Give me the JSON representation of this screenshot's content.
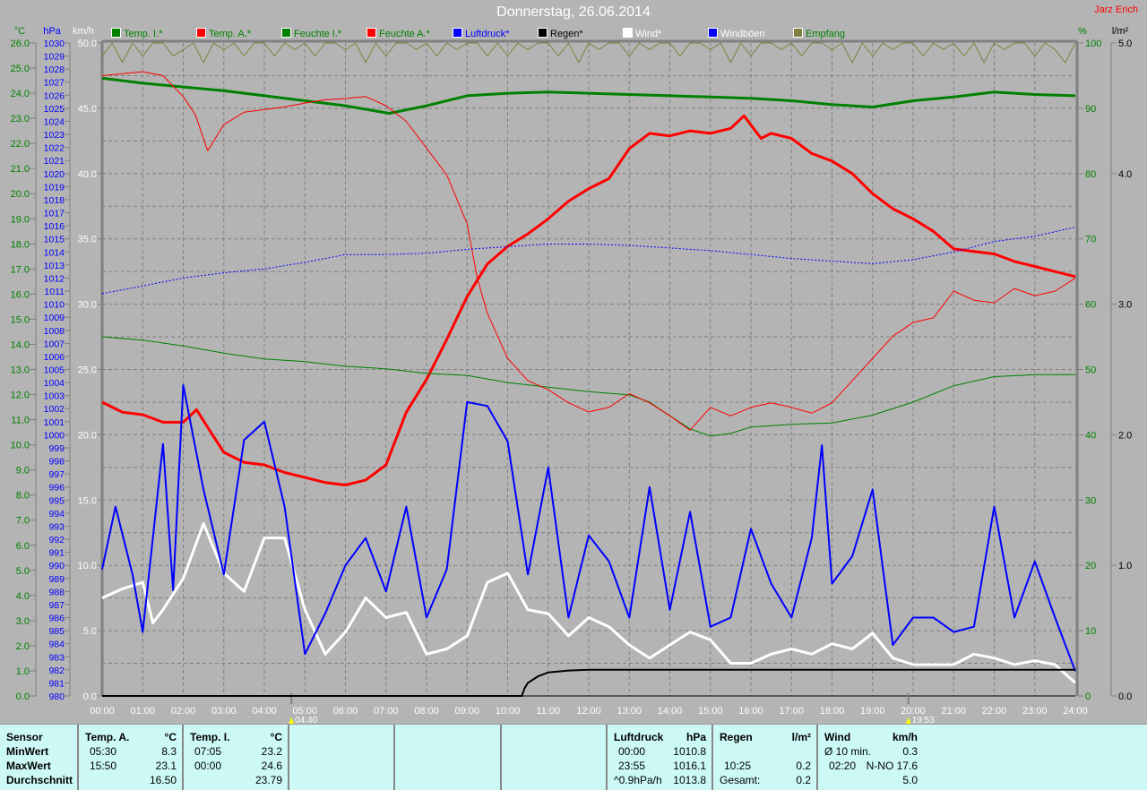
{
  "header": {
    "title": "Donnerstag, 26.06.2014",
    "author": "Jarz Erich"
  },
  "legend": [
    {
      "label": "Temp. I.*",
      "swatch": "#008000",
      "text_color": "#008000"
    },
    {
      "label": "Temp. A.*",
      "swatch": "#ff0000",
      "text_color": "#008000"
    },
    {
      "label": "Feuchte I.*",
      "swatch": "#008000",
      "text_color": "#008000"
    },
    {
      "label": "Feuchte A.*",
      "swatch": "#ff0000",
      "text_color": "#008000"
    },
    {
      "label": "Luftdruck*",
      "swatch": "#0000ff",
      "text_color": "#0000ff"
    },
    {
      "label": "Regen*",
      "swatch": "#000000",
      "text_color": "#000000"
    },
    {
      "label": "Wind*",
      "swatch": "#ffffff",
      "text_color": "#ffffff"
    },
    {
      "label": "Windböen",
      "swatch": "#0000ff",
      "text_color": "#ffffff"
    },
    {
      "label": "Empfang",
      "swatch": "#808040",
      "text_color": "#008000"
    }
  ],
  "chart_data": {
    "type": "line",
    "title": "Donnerstag, 26.06.2014",
    "x_unit": "hours",
    "xlim": [
      0,
      24
    ],
    "x_tick_labels": [
      "00:00",
      "01:00",
      "02:00",
      "03:00",
      "04:00",
      "05:00",
      "06:00",
      "07:00",
      "08:00",
      "09:00",
      "10:00",
      "11:00",
      "12:00",
      "13:00",
      "14:00",
      "15:00",
      "16:00",
      "17:00",
      "18:00",
      "19:00",
      "20:00",
      "21:00",
      "22:00",
      "23:00",
      "24:00"
    ],
    "axes": {
      "temp": {
        "unit": "°C",
        "range": [
          0,
          26
        ],
        "step": 1,
        "color": "#008000"
      },
      "pressure": {
        "unit": "hPa",
        "range": [
          980,
          1030
        ],
        "step": 1,
        "color": "#0000ff"
      },
      "wind": {
        "unit": "km/h",
        "range": [
          0,
          50
        ],
        "step": 5,
        "color": "#ffffff"
      },
      "humidity": {
        "unit": "%",
        "range": [
          0,
          100
        ],
        "step": 10,
        "color": "#008000"
      },
      "rain": {
        "unit": "l/m²",
        "range": [
          0,
          5
        ],
        "step": 1,
        "color": "#000000"
      }
    },
    "grid": true,
    "markers": [
      {
        "time": "04:40",
        "x": 4.667
      },
      {
        "time": "19:53",
        "x": 19.883
      }
    ],
    "series": [
      {
        "name": "Empfang",
        "axis": "humidity",
        "color": "#808040",
        "width": 1,
        "x": [
          0,
          0.25,
          0.5,
          0.75,
          1,
          1.25,
          1.5,
          1.75,
          2,
          2.25,
          2.5,
          2.75,
          3,
          3.25,
          3.5,
          3.75,
          4,
          4.25,
          4.5,
          4.75,
          5,
          5.25,
          5.5,
          5.75,
          6,
          6.25,
          6.5,
          6.75,
          7,
          7.25,
          7.5,
          7.75,
          8,
          8.25,
          8.5,
          8.75,
          9,
          9.25,
          9.5,
          9.75,
          10,
          10.25,
          10.5,
          10.75,
          11,
          11.25,
          11.5,
          11.75,
          12,
          12.25,
          12.5,
          12.75,
          13,
          13.25,
          13.5,
          13.75,
          14,
          14.25,
          14.5,
          14.75,
          15,
          15.25,
          15.5,
          15.75,
          16,
          16.25,
          16.5,
          16.75,
          17,
          17.25,
          17.5,
          17.75,
          18,
          18.25,
          18.5,
          18.75,
          19,
          19.25,
          19.5,
          19.75,
          20,
          20.25,
          20.5,
          20.75,
          21,
          21.25,
          21.5,
          21.75,
          22,
          22.25,
          22.5,
          22.75,
          23,
          23.25,
          23.5,
          23.75,
          24
        ],
        "y": [
          98,
          100,
          97,
          100,
          98,
          100,
          100,
          98,
          99,
          100,
          97,
          100,
          99,
          100,
          98,
          100,
          100,
          98,
          100,
          99,
          100,
          98,
          100,
          100,
          99,
          100,
          97,
          100,
          98,
          100,
          100,
          99,
          100,
          98,
          100,
          99,
          100,
          100,
          98,
          100,
          98,
          100,
          99,
          100,
          100,
          98,
          100,
          97,
          100,
          99,
          100,
          100,
          98,
          100,
          99,
          100,
          100,
          98,
          100,
          100,
          99,
          100,
          97,
          100,
          98,
          100,
          100,
          99,
          100,
          98,
          100,
          100,
          99,
          100,
          97,
          100,
          98,
          100,
          99,
          100,
          100,
          98,
          100,
          99,
          100,
          98,
          100,
          97,
          100,
          99,
          100,
          100,
          98,
          100,
          99,
          97,
          100
        ]
      },
      {
        "name": "Temp. I.",
        "axis": "temp",
        "color": "#008000",
        "width": 3,
        "x": [
          0,
          1,
          2,
          3,
          4,
          5,
          6,
          7.08,
          8,
          9,
          10,
          11,
          12,
          13,
          14,
          15,
          16,
          17,
          18,
          19,
          20,
          21,
          22,
          23,
          24
        ],
        "y": [
          24.6,
          24.4,
          24.25,
          24.1,
          23.9,
          23.7,
          23.5,
          23.2,
          23.5,
          23.9,
          24.0,
          24.05,
          24.0,
          23.95,
          23.9,
          23.85,
          23.8,
          23.7,
          23.55,
          23.45,
          23.7,
          23.85,
          24.05,
          23.95,
          23.9
        ]
      },
      {
        "name": "Temp. A.",
        "axis": "temp",
        "color": "#ff0000",
        "width": 3,
        "x": [
          0,
          0.5,
          1,
          1.5,
          2,
          2.33,
          2.6,
          3,
          3.5,
          4,
          4.5,
          5,
          5.5,
          6,
          6.5,
          7,
          7.5,
          8,
          8.5,
          9,
          9.5,
          10,
          10.5,
          11,
          11.5,
          12,
          12.5,
          13,
          13.5,
          14,
          14.5,
          15,
          15.5,
          15.83,
          16.25,
          16.5,
          17,
          17.5,
          18,
          18.5,
          19,
          19.5,
          20,
          20.5,
          21,
          21.5,
          22,
          22.5,
          23,
          23.5,
          24
        ],
        "y": [
          11.7,
          11.3,
          11.2,
          10.9,
          10.9,
          11.4,
          10.7,
          9.7,
          9.3,
          9.2,
          8.9,
          8.7,
          8.5,
          8.4,
          8.6,
          9.2,
          11.3,
          12.6,
          14.2,
          15.9,
          17.2,
          17.9,
          18.4,
          19.0,
          19.7,
          20.2,
          20.6,
          21.8,
          22.4,
          22.3,
          22.5,
          22.4,
          22.6,
          23.1,
          22.2,
          22.4,
          22.2,
          21.6,
          21.3,
          20.8,
          20.0,
          19.4,
          19.0,
          18.5,
          17.8,
          17.7,
          17.6,
          17.3,
          17.1,
          16.9,
          16.7
        ]
      },
      {
        "name": "Feuchte I.",
        "axis": "humidity",
        "color": "#008000",
        "width": 1,
        "x": [
          0,
          1,
          2,
          3,
          4,
          5,
          6,
          7,
          8,
          9,
          10,
          11,
          12,
          13,
          13.5,
          14,
          14.5,
          15,
          15.5,
          16,
          17,
          18,
          19,
          20,
          21,
          22,
          23,
          24
        ],
        "y": [
          55,
          54.5,
          53.6,
          52.5,
          51.6,
          51.2,
          50.5,
          50.1,
          49.4,
          49.1,
          48,
          47.3,
          46.6,
          46.1,
          45,
          42.9,
          40.9,
          39.8,
          40.2,
          41.2,
          41.6,
          41.8,
          43,
          45,
          47.5,
          48.9,
          49.2,
          49.2
        ]
      },
      {
        "name": "Feuchte A.",
        "axis": "humidity",
        "color": "#ff0000",
        "width": 1,
        "x": [
          0,
          0.5,
          1,
          1.5,
          2,
          2.3,
          2.6,
          3,
          3.5,
          4,
          4.5,
          5,
          5.5,
          6,
          6.5,
          7,
          7.5,
          8,
          8.5,
          9,
          9.25,
          9.5,
          10,
          10.5,
          11,
          11.5,
          12,
          12.5,
          13,
          13.5,
          14,
          14.5,
          15,
          15.5,
          16,
          16.5,
          17,
          17.5,
          18,
          18.5,
          19,
          19.5,
          20,
          20.5,
          21,
          21.5,
          22,
          22.5,
          23,
          23.5,
          24
        ],
        "y": [
          95,
          95.3,
          95.6,
          95,
          91.8,
          89,
          83.5,
          87.5,
          89.4,
          89.8,
          90.2,
          90.8,
          91.3,
          91.5,
          91.8,
          90.4,
          88,
          83.9,
          79.8,
          72.3,
          64,
          58.6,
          51.7,
          48.3,
          46.9,
          44.9,
          43.5,
          44.2,
          46.3,
          44.9,
          42.9,
          40.7,
          44.2,
          42.9,
          44.2,
          44.9,
          44.2,
          43.3,
          44.9,
          48.3,
          51.7,
          55.1,
          57.2,
          57.9,
          62,
          60.6,
          60.2,
          62.4,
          61.3,
          62,
          64
        ]
      },
      {
        "name": "Luftdruck",
        "axis": "pressure",
        "color": "#0000ff",
        "width": 1,
        "dash": true,
        "x": [
          0,
          1,
          2,
          3,
          4,
          5,
          6,
          7,
          8,
          9,
          10,
          11,
          12,
          13,
          14,
          15,
          16,
          17,
          18,
          19,
          20,
          21,
          22,
          23,
          24
        ],
        "y": [
          1010.8,
          1011.4,
          1012.0,
          1012.4,
          1012.7,
          1013.2,
          1013.8,
          1013.8,
          1013.9,
          1014.2,
          1014.4,
          1014.6,
          1014.6,
          1014.5,
          1014.3,
          1014.1,
          1013.8,
          1013.5,
          1013.3,
          1013.1,
          1013.4,
          1014.0,
          1014.8,
          1015.2,
          1015.9
        ]
      },
      {
        "name": "Wind",
        "axis": "wind",
        "color": "#ffffff",
        "width": 3,
        "x": [
          0,
          0.5,
          1,
          1.25,
          1.5,
          2,
          2.5,
          3,
          3.5,
          4,
          4.5,
          5,
          5.5,
          6,
          6.5,
          7,
          7.5,
          8,
          8.5,
          9,
          9.5,
          10,
          10.5,
          11,
          11.5,
          12,
          12.5,
          13,
          13.5,
          14,
          14.5,
          15,
          15.5,
          16,
          16.5,
          17,
          17.5,
          18,
          18.5,
          19,
          19.5,
          20,
          20.5,
          21,
          21.5,
          22,
          22.5,
          23,
          23.5,
          24
        ],
        "y": [
          7.5,
          8.2,
          8.7,
          5.6,
          6.6,
          9.0,
          13.2,
          9.4,
          8.0,
          12.1,
          12.1,
          6.6,
          3.2,
          4.9,
          7.5,
          6.0,
          6.4,
          3.2,
          3.6,
          4.6,
          8.7,
          9.4,
          6.6,
          6.3,
          4.6,
          6.0,
          5.3,
          3.9,
          2.9,
          3.9,
          4.9,
          4.3,
          2.5,
          2.5,
          3.2,
          3.6,
          3.2,
          4.0,
          3.6,
          4.8,
          2.9,
          2.4,
          2.4,
          2.4,
          3.2,
          2.9,
          2.4,
          2.7,
          2.4,
          1.0
        ]
      },
      {
        "name": "Windböen",
        "axis": "wind",
        "color": "#0000ff",
        "width": 2,
        "x": [
          0,
          0.33,
          0.75,
          1,
          1.5,
          1.75,
          2,
          2.5,
          3,
          3.5,
          4,
          4.5,
          5,
          5.5,
          6,
          6.5,
          7,
          7.5,
          8,
          8.5,
          9,
          9.5,
          10,
          10.5,
          11,
          11.5,
          12,
          12.5,
          13,
          13.5,
          14,
          14.5,
          15,
          15.5,
          16,
          16.5,
          17,
          17.5,
          17.75,
          18,
          18.5,
          19,
          19.5,
          20,
          20.5,
          21,
          21.5,
          22,
          22.5,
          23,
          23.5,
          24
        ],
        "y": [
          9.7,
          14.5,
          9.3,
          4.9,
          19.3,
          8.1,
          23.8,
          15.8,
          9.3,
          19.6,
          21.0,
          14.5,
          3.2,
          6.3,
          10.0,
          12.1,
          8.0,
          14.5,
          6.0,
          9.7,
          22.5,
          22.2,
          19.5,
          9.3,
          17.5,
          6.0,
          12.3,
          10.3,
          6.0,
          16.0,
          6.6,
          14.1,
          5.3,
          6.0,
          12.8,
          8.6,
          6.0,
          12.1,
          19.2,
          8.6,
          10.7,
          15.8,
          3.9,
          6.0,
          6.0,
          4.9,
          5.3,
          14.5,
          6.0,
          10.3,
          6.0,
          1.9
        ]
      },
      {
        "name": "Regen",
        "axis": "rain",
        "color": "#000000",
        "width": 2,
        "x": [
          0,
          10.35,
          10.42,
          10.5,
          10.75,
          11,
          11.5,
          12,
          24
        ],
        "y": [
          0,
          0,
          0.06,
          0.1,
          0.15,
          0.18,
          0.195,
          0.2,
          0.2
        ]
      }
    ]
  },
  "stats": {
    "labels": {
      "title": "Sensor",
      "min": "MinWert",
      "max": "MaxWert",
      "avg": "Durchschnitt"
    },
    "temp_a": {
      "head": "Temp. A.",
      "unit": "°C",
      "min_time": "05:30",
      "min": "8.3",
      "max_time": "15:50",
      "max": "23.1",
      "avg": "16.50"
    },
    "temp_i": {
      "head": "Temp. I.",
      "unit": "°C",
      "min_time": "07:05",
      "min": "23.2",
      "max_time": "00:00",
      "max": "24.6",
      "avg": "23.79"
    },
    "pressure": {
      "head": "Luftdruck",
      "unit": "hPa",
      "t1": "00:00",
      "v1": "1010.8",
      "t2": "23:55",
      "v2": "1016.1",
      "t3": "^0.9hPa/h",
      "v3": "1013.8"
    },
    "rain": {
      "head": "Regen",
      "unit": "l/m²",
      "t2": "10:25",
      "v2": "0.2",
      "t3": "Gesamt:",
      "v3": "0.2"
    },
    "wind": {
      "head": "Wind",
      "unit": "km/h",
      "t1": "Ø 10 min.",
      "v1": "0.3",
      "t2": "02:20",
      "v2": "N-NO 17.6",
      "v3": "5.0"
    }
  }
}
